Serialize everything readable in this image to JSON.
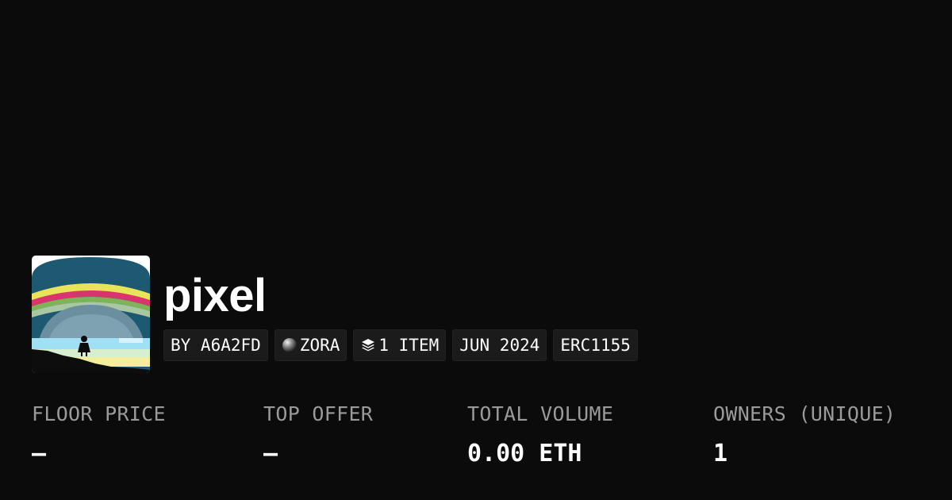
{
  "collection": {
    "name": "pixel",
    "image_icon": "rainbow-pixel-art-thumbnail"
  },
  "tags": {
    "creator": "BY A6A2FD",
    "chain": "ZORA",
    "chain_icon": "zora-orb-icon",
    "items": "1 ITEM",
    "items_icon": "layers-icon",
    "date": "JUN 2024",
    "standard": "ERC1155"
  },
  "stats": {
    "floor_price": {
      "label": "FLOOR PRICE",
      "value": "–"
    },
    "top_offer": {
      "label": "TOP OFFER",
      "value": "–"
    },
    "total_volume": {
      "label": "TOTAL VOLUME",
      "value": "0.00 ETH"
    },
    "owners": {
      "label": "OWNERS (UNIQUE)",
      "value": "1"
    }
  },
  "colors": {
    "background": "#0b0b0b",
    "tag_background": "#1b1b1b",
    "label_gray": "#9a9a9a",
    "text_white": "#ffffff"
  }
}
